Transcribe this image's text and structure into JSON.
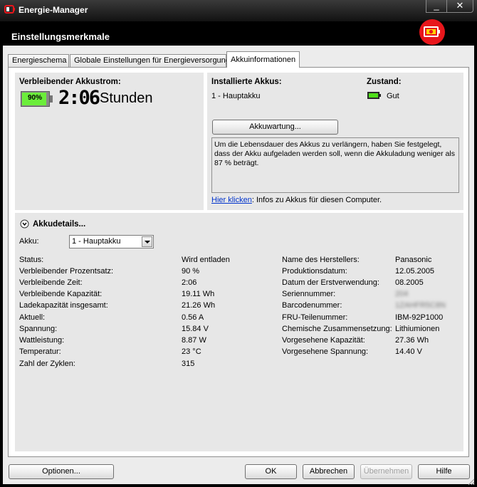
{
  "window": {
    "title": "Energie-Manager",
    "header_title": "Einstellungsmerkmale",
    "minimize_label": "_",
    "close_label": "✕",
    "badge_color": "#e8161b"
  },
  "tabs": [
    {
      "label": "Energieschema"
    },
    {
      "label": "Globale Einstellungen für Energieversorgung"
    },
    {
      "label": "Akkuinformationen"
    }
  ],
  "remaining": {
    "heading": "Verbleibender Akkustrom:",
    "percent_badge": "90%",
    "percent_value": 0.9,
    "time": "2:06",
    "unit": "Stunden"
  },
  "installed": {
    "heading": "Installierte Akkus:",
    "item": "1 - Hauptakku",
    "state_heading": "Zustand:",
    "state_value": "Gut",
    "maintenance_button": "Akkuwartung...",
    "info_text": "Um die Lebensdauer des Akkus zu verlängern, haben Sie festgelegt, dass der Akku aufgeladen werden soll, wenn die Akkuladung weniger als 87 % beträgt.",
    "link_text": "Hier klicken",
    "link_suffix": ": Infos zu Akkus für diesen Computer."
  },
  "details": {
    "heading": "Akkudetails...",
    "akku_label": "Akku:",
    "akku_selected": "1 - Hauptakku",
    "left_rows": [
      {
        "label": "Status:",
        "value": "Wird entladen"
      },
      {
        "label": "Verbleibender Prozentsatz:",
        "value": "90 %"
      },
      {
        "label": "Verbleibende Zeit:",
        "value": "2:06"
      },
      {
        "label": "Verbleibende Kapazität:",
        "value": "19.11 Wh"
      },
      {
        "label": "Ladekapazität insgesamt:",
        "value": "21.26 Wh"
      },
      {
        "label": "Aktuell:",
        "value": "0.56 A"
      },
      {
        "label": "Spannung:",
        "value": "15.84 V"
      },
      {
        "label": "Wattleistung:",
        "value": "8.87 W"
      },
      {
        "label": "Temperatur:",
        "value": "23 °C"
      },
      {
        "label": "Zahl der Zyklen:",
        "value": "315"
      }
    ],
    "right_rows": [
      {
        "label": "Name des Herstellers:",
        "value": "Panasonic"
      },
      {
        "label": "Produktionsdatum:",
        "value": "12.05.2005"
      },
      {
        "label": "Datum der Erstverwendung:",
        "value": "08.2005"
      },
      {
        "label": "Seriennummer:",
        "value": "204"
      },
      {
        "label": "Barcodenummer:",
        "value": "1ZAHFR5C8N"
      },
      {
        "label": "FRU-Teilenummer:",
        "value": "IBM-92P1000"
      },
      {
        "label": "Chemische Zusammensetzung:",
        "value": "Lithiumionen"
      },
      {
        "label": "Vorgesehene Kapazität:",
        "value": "27.36 Wh"
      },
      {
        "label": "Vorgesehene Spannung:",
        "value": "14.40 V"
      }
    ]
  },
  "footer": {
    "options": "Optionen...",
    "ok": "OK",
    "cancel": "Abbrechen",
    "apply": "Übernehmen",
    "help": "Hilfe"
  }
}
